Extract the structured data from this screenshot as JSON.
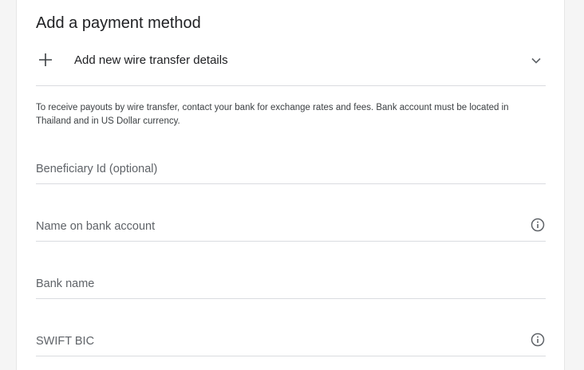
{
  "payment": {
    "title": "Add a payment method",
    "add_option": {
      "icon": "plus-icon",
      "label": "Add new wire transfer details",
      "toggle_icon": "chevron-down-icon"
    },
    "notice": "To receive payouts by wire transfer, contact your bank for exchange rates and fees. Bank account must be located in Thailand and in US Dollar currency.",
    "fields": [
      {
        "placeholder": "Beneficiary Id (optional)",
        "value": "",
        "has_info": false
      },
      {
        "placeholder": "Name on bank account",
        "value": "",
        "has_info": true,
        "info_icon": "info-icon"
      },
      {
        "placeholder": "Bank name",
        "value": "",
        "has_info": false
      },
      {
        "placeholder": "SWIFT BIC",
        "value": "",
        "has_info": true,
        "info_icon": "info-icon"
      }
    ]
  },
  "colors": {
    "divider": "#dadce0",
    "placeholder": "#5f6368",
    "text": "#202124",
    "icon": "#5f6368"
  }
}
